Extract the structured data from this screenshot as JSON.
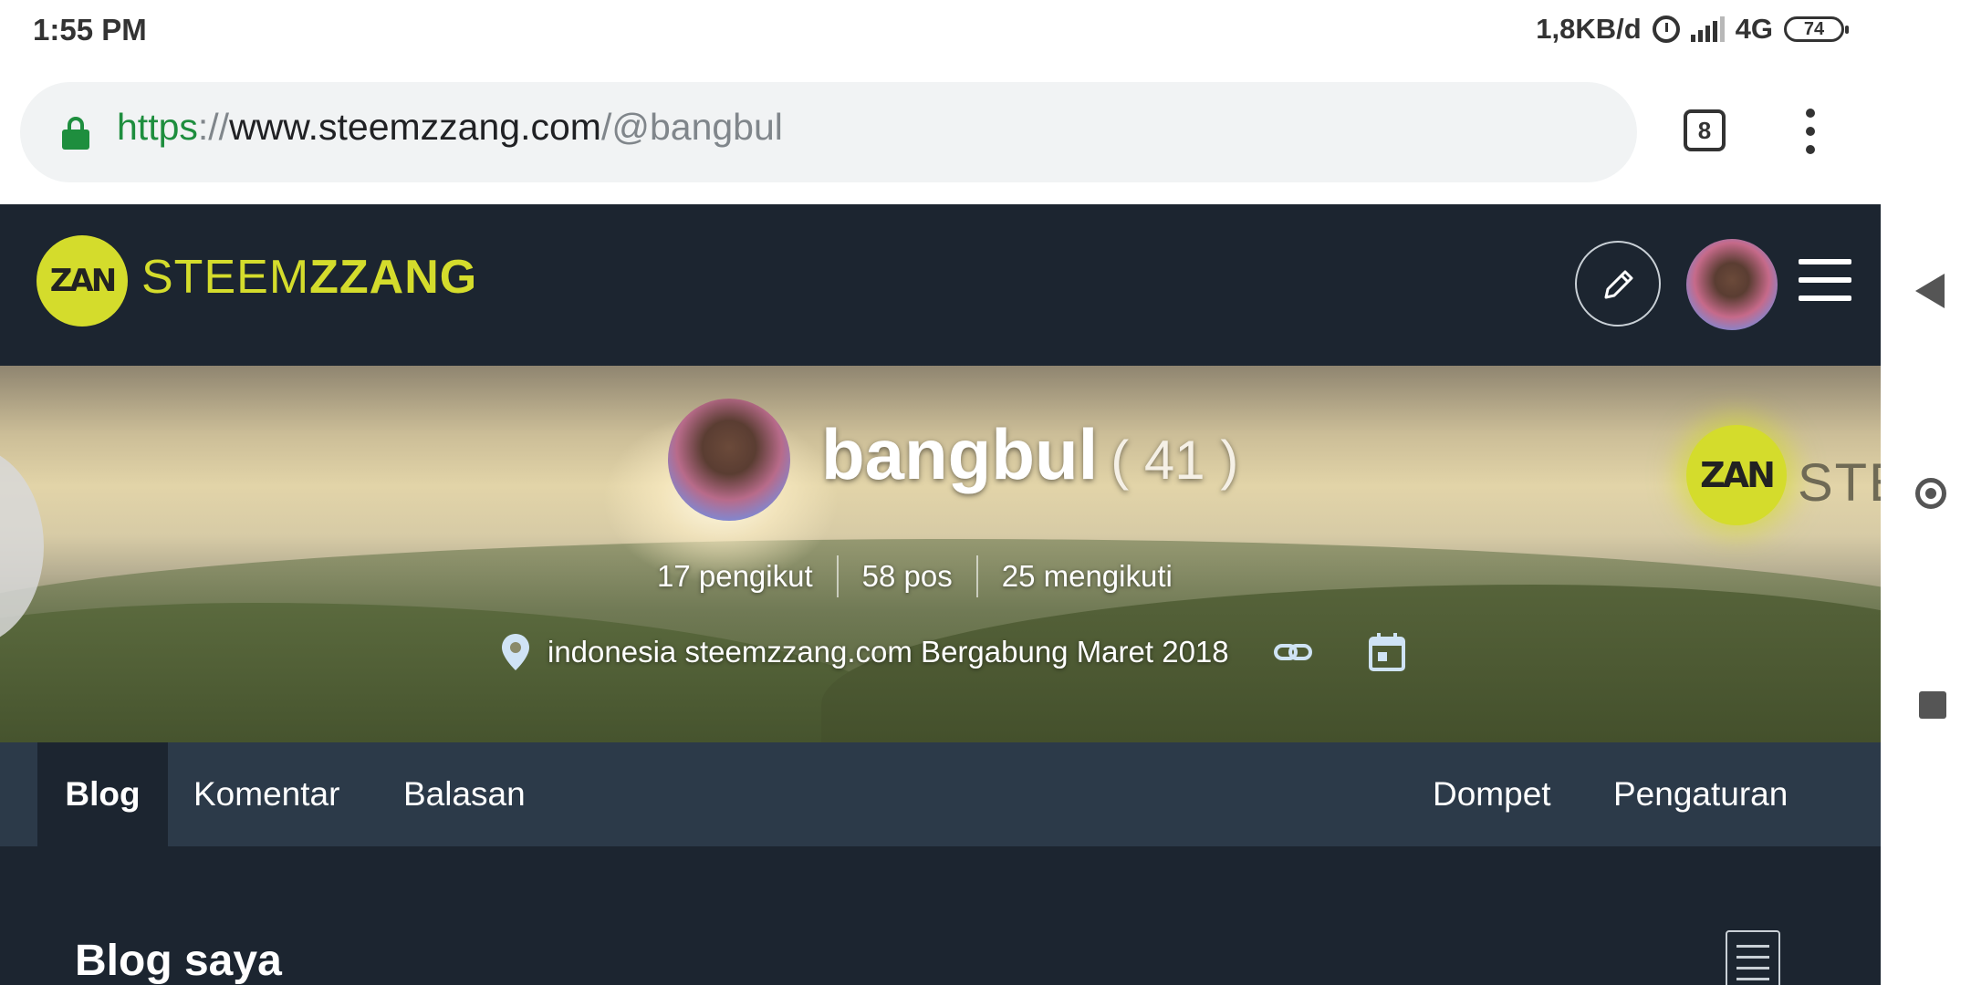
{
  "status_bar": {
    "time": "1:55 PM",
    "data_rate": "1,8KB/d",
    "network": "4G",
    "battery": "74"
  },
  "browser": {
    "url_scheme": "https",
    "url_sep": "://",
    "url_host": "www.steemzzang.com",
    "url_slash": "/",
    "url_path": "@bangbul",
    "tab_count": "8"
  },
  "site": {
    "logo_mark": "ZAN",
    "logo_text_light": "STEEM",
    "logo_text_bold": "ZZANG"
  },
  "profile": {
    "name": "bangbul",
    "reputation": "( 41 )",
    "followers": "17 pengikut",
    "posts": "58 pos",
    "following": "25 mengikuti",
    "meta": "indonesia steemzzang.com Bergabung Maret 2018",
    "banner_logo_mark": "ZAN",
    "banner_logo_text": "STE"
  },
  "tabs": {
    "blog": "Blog",
    "comments": "Komentar",
    "replies": "Balasan",
    "wallet": "Dompet",
    "settings": "Pengaturan"
  },
  "content": {
    "title": "Blog saya"
  },
  "colors": {
    "brand": "#d4dc2c",
    "header_bg": "#1c2530",
    "tabs_bg": "#2c3a49",
    "secure_green": "#1e8e3e"
  }
}
